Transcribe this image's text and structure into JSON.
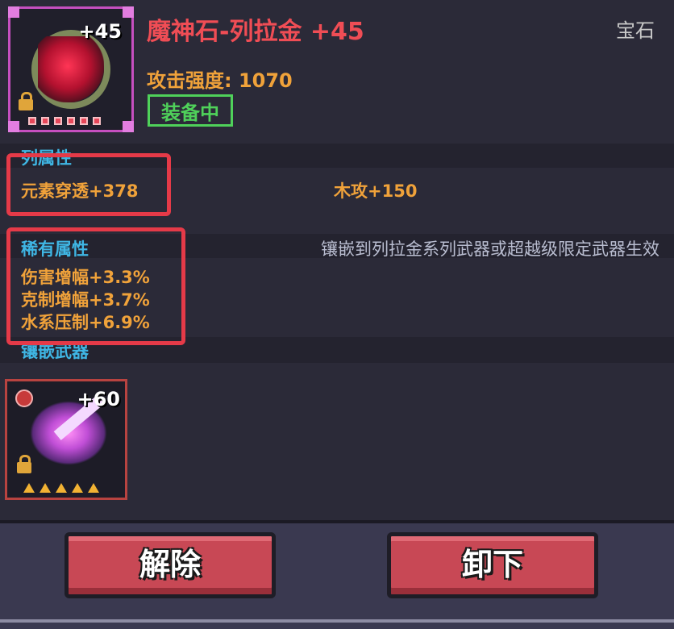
{
  "item": {
    "name": "魔神石-列拉金 +45",
    "category": "宝石",
    "enhance_level": "+45",
    "attack_label": "攻击强度: 1070",
    "status_badge": "装备中",
    "icon": "gem-icon"
  },
  "sections": {
    "attribute_title": "列属性",
    "attributes": [
      "元素穿透+378",
      "木攻+150"
    ],
    "rare_title": "稀有属性",
    "rare_note": "镶嵌到列拉金系列武器或超越级限定武器生效",
    "rare_attributes": [
      "伤害增幅+3.3%",
      "克制增幅+3.7%",
      "水系压制+6.9%"
    ],
    "inlay_title": "镶嵌武器"
  },
  "weapon": {
    "enhance_level": "+60",
    "icon": "sword-icon",
    "stars": 5
  },
  "buttons": {
    "remove": "解除",
    "unequip": "卸下"
  },
  "colors": {
    "title": "#f04d55",
    "stat": "#f0a23a",
    "section": "#3fb6e4",
    "equipped": "#4fd15a",
    "highlight": "#e53a48",
    "button": "#c84855"
  }
}
